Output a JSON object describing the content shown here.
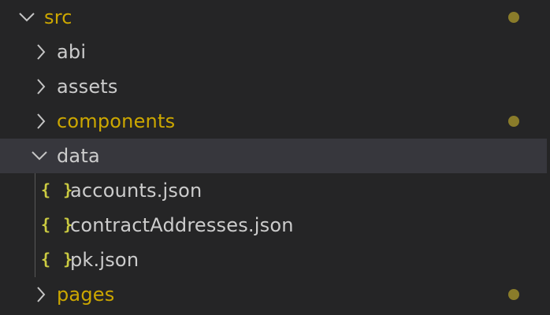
{
  "explorer": {
    "colors": {
      "background": "#252526",
      "selected_row": "#37373d",
      "modified_text": "#cca700",
      "normal_text": "#cccccc",
      "json_icon": "#cbcb41",
      "modified_dot": "#8a7c2a"
    },
    "src": {
      "label": "src",
      "expanded": true,
      "modified": true
    },
    "abi": {
      "label": "abi",
      "expanded": false
    },
    "assets": {
      "label": "assets",
      "expanded": false
    },
    "components": {
      "label": "components",
      "expanded": false,
      "modified": true
    },
    "data": {
      "label": "data",
      "expanded": true,
      "selected": true
    },
    "files": [
      {
        "label": "accounts.json",
        "icon": "json-icon",
        "glyph": "{ }"
      },
      {
        "label": "contractAddresses.json",
        "icon": "json-icon",
        "glyph": "{ }"
      },
      {
        "label": "pk.json",
        "icon": "json-icon",
        "glyph": "{ }"
      }
    ],
    "pages": {
      "label": "pages",
      "expanded": false,
      "modified": true
    }
  }
}
